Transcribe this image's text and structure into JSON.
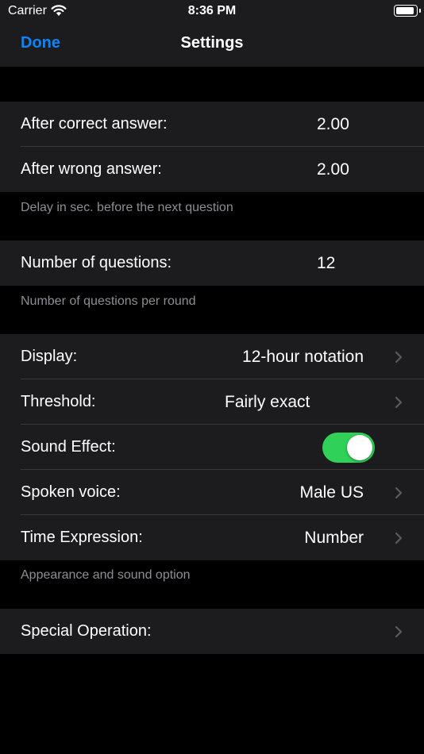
{
  "status_bar": {
    "carrier": "Carrier",
    "time": "8:36 PM",
    "battery_level": 0.85
  },
  "nav": {
    "done_label": "Done",
    "title": "Settings"
  },
  "delay_section": {
    "rows": [
      {
        "label": "After correct answer:",
        "value": "2.00"
      },
      {
        "label": "After wrong answer:",
        "value": "2.00"
      }
    ],
    "footer": "Delay in sec. before the next question"
  },
  "questions_section": {
    "rows": [
      {
        "label": "Number of questions:",
        "value": "12"
      }
    ],
    "footer": "Number of questions per round"
  },
  "appearance_section": {
    "display": {
      "label": "Display:",
      "value": "12-hour notation"
    },
    "threshold": {
      "label": "Threshold:",
      "value": "Fairly exact"
    },
    "sound": {
      "label": "Sound Effect:",
      "on": true
    },
    "voice": {
      "label": "Spoken voice:",
      "value": "Male US"
    },
    "time_expr": {
      "label": "Time Expression:",
      "value": "Number"
    },
    "footer": "Appearance and sound option"
  },
  "special_section": {
    "special": {
      "label": "Special Operation:"
    }
  },
  "colors": {
    "accent": "#0a84ff",
    "toggle_on": "#30d158",
    "row_bg": "#1c1c1e",
    "footer_text": "#8d8d93"
  }
}
